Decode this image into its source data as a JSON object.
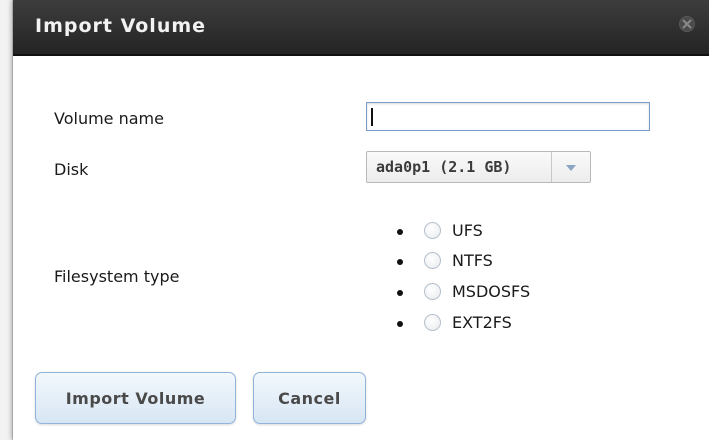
{
  "dialog": {
    "title": "Import Volume",
    "close_icon": "close-icon"
  },
  "form": {
    "volume_name": {
      "label": "Volume name",
      "value": ""
    },
    "disk": {
      "label": "Disk",
      "selected": "ada0p1 (2.1 GB)",
      "arrow_icon": "chevron-down-icon"
    },
    "filesystem": {
      "label": "Filesystem type",
      "options": [
        "UFS",
        "NTFS",
        "MSDOSFS",
        "EXT2FS"
      ]
    }
  },
  "buttons": {
    "import": "Import Volume",
    "cancel": "Cancel"
  },
  "colors": {
    "titlebar": "#2f2f2f",
    "button_border": "#8fb3d9",
    "input_border": "#7a9cc8"
  }
}
